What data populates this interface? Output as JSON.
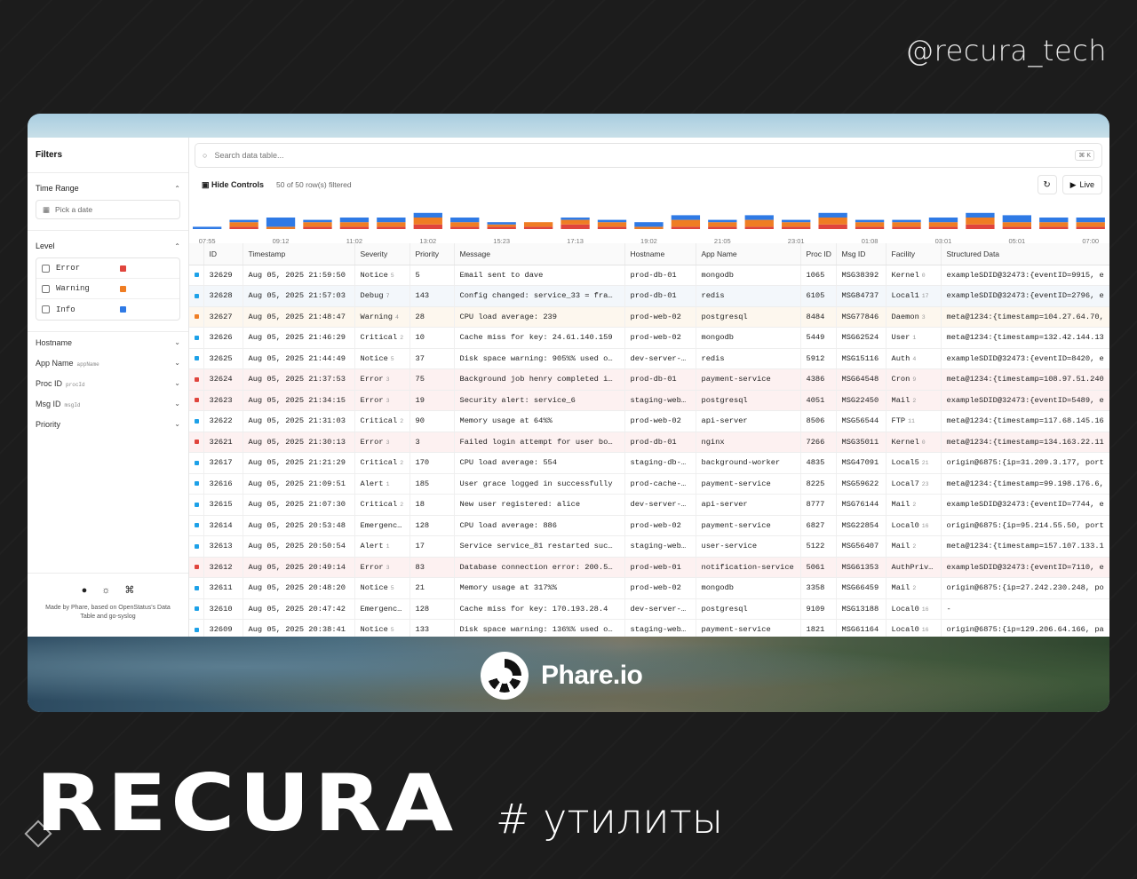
{
  "handle": "@recura_tech",
  "brand": {
    "name": "Phare.io"
  },
  "footer_brand": {
    "name": "RECURA",
    "tagline": "# утилиты"
  },
  "sidebar": {
    "title": "Filters",
    "time_range": {
      "label": "Time Range",
      "placeholder": "Pick a date"
    },
    "level": {
      "label": "Level",
      "items": [
        {
          "label": "Error",
          "color": "#e0453d"
        },
        {
          "label": "Warning",
          "color": "#ef7d23"
        },
        {
          "label": "Info",
          "color": "#2f7ae5"
        }
      ]
    },
    "facets": [
      {
        "label": "Hostname",
        "hint": ""
      },
      {
        "label": "App Name",
        "hint": "appName"
      },
      {
        "label": "Proc ID",
        "hint": "procId"
      },
      {
        "label": "Msg ID",
        "hint": "msgId"
      },
      {
        "label": "Priority",
        "hint": ""
      }
    ],
    "footer": {
      "line1": "Made by Phare, based on OpenStatus's Data",
      "line2": "Table and go-syslog"
    }
  },
  "search": {
    "placeholder": "Search data table...",
    "shortcut": "⌘ K"
  },
  "controls": {
    "hide_label": "Hide Controls",
    "count_label": "50 of 50 row(s) filtered",
    "live_label": "Live"
  },
  "chart_data": {
    "type": "bar",
    "categories": [
      "07:55",
      "",
      "09:12",
      "",
      "11:02",
      "",
      "13:02",
      "",
      "15:23",
      "",
      "17:13",
      "",
      "19:02",
      "",
      "21:05",
      "",
      "23:01",
      "",
      "01:08",
      "",
      "03:01",
      "",
      "05:01",
      "",
      "07:00"
    ],
    "tick_labels": [
      "07:55",
      "09:12",
      "11:02",
      "13:02",
      "15:23",
      "17:13",
      "19:02",
      "21:05",
      "23:01",
      "01:08",
      "03:01",
      "05:01",
      "07:00"
    ],
    "series": [],
    "values_blue": [
      1,
      1,
      4,
      1,
      2,
      2,
      2,
      2,
      1,
      0,
      1,
      1,
      2,
      2,
      1,
      2,
      1,
      2,
      1,
      1,
      2,
      2,
      3,
      2,
      2
    ],
    "values_orange": [
      0,
      2,
      1,
      2,
      2,
      2,
      3,
      2,
      1,
      2,
      2,
      2,
      1,
      3,
      2,
      3,
      2,
      3,
      2,
      2,
      2,
      3,
      2,
      2,
      2
    ],
    "values_red": [
      0,
      1,
      0,
      1,
      1,
      1,
      2,
      1,
      1,
      1,
      2,
      1,
      0,
      1,
      1,
      1,
      1,
      2,
      1,
      1,
      1,
      2,
      1,
      1,
      1
    ],
    "colors": {
      "blue": "#2f7ae5",
      "orange": "#ef7d23",
      "red": "#e0453d"
    }
  },
  "table": {
    "columns": [
      "ID",
      "Timestamp",
      "Severity",
      "Priority",
      "Message",
      "Hostname",
      "App Name",
      "Proc ID",
      "Msg ID",
      "Facility",
      "Structured Data"
    ],
    "rows": [
      {
        "lv": "info",
        "color": "#1da1e8",
        "id": "32629",
        "ts": "Aug 05, 2025 21:59:50",
        "sev": "Notice",
        "sevn": "5",
        "pri": "5",
        "msg": "Email sent to dave",
        "host": "prod-db-01",
        "app": "mongodb",
        "proc": "1065",
        "msgid": "MSG38392",
        "fac": "Kernel",
        "facn": "0",
        "sd": "exampleSDID@32473:{eventID=9915, e"
      },
      {
        "lv": "info",
        "color": "#1da1e8",
        "id": "32628",
        "ts": "Aug 05, 2025 21:57:03",
        "sev": "Debug",
        "sevn": "7",
        "pri": "143",
        "msg": "Config changed: service_33 = fra…",
        "host": "prod-db-01",
        "app": "redis",
        "proc": "6105",
        "msgid": "MSG84737",
        "fac": "Local1",
        "facn": "17",
        "sd": "exampleSDID@32473:{eventID=2796, e"
      },
      {
        "lv": "warning",
        "color": "#ef7d23",
        "id": "32627",
        "ts": "Aug 05, 2025 21:48:47",
        "sev": "Warning",
        "sevn": "4",
        "pri": "28",
        "msg": "CPU load average: 239",
        "host": "prod-web-02",
        "app": "postgresql",
        "proc": "8484",
        "msgid": "MSG77846",
        "fac": "Daemon",
        "facn": "3",
        "sd": "meta@1234:{timestamp=104.27.64.70,"
      },
      {
        "lv": "info",
        "color": "#1da1e8",
        "id": "32626",
        "ts": "Aug 05, 2025 21:46:29",
        "sev": "Critical",
        "sevn": "2",
        "pri": "10",
        "msg": "Cache miss for key: 24.61.140.159",
        "host": "prod-web-02",
        "app": "mongodb",
        "proc": "5449",
        "msgid": "MSG62524",
        "fac": "User",
        "facn": "1",
        "sd": "meta@1234:{timestamp=132.42.144.13"
      },
      {
        "lv": "info",
        "color": "#1da1e8",
        "id": "32625",
        "ts": "Aug 05, 2025 21:44:49",
        "sev": "Notice",
        "sevn": "5",
        "pri": "37",
        "msg": "Disk space warning: 905%% used o…",
        "host": "dev-server-…",
        "app": "redis",
        "proc": "5912",
        "msgid": "MSG15116",
        "fac": "Auth",
        "facn": "4",
        "sd": "exampleSDID@32473:{eventID=8420, e"
      },
      {
        "lv": "error",
        "color": "#e0453d",
        "id": "32624",
        "ts": "Aug 05, 2025 21:37:53",
        "sev": "Error",
        "sevn": "3",
        "pri": "75",
        "msg": "Background job henry completed i…",
        "host": "prod-db-01",
        "app": "payment-service",
        "proc": "4386",
        "msgid": "MSG64548",
        "fac": "Cron",
        "facn": "9",
        "sd": "meta@1234:{timestamp=108.97.51.240"
      },
      {
        "lv": "error",
        "color": "#e0453d",
        "id": "32623",
        "ts": "Aug 05, 2025 21:34:15",
        "sev": "Error",
        "sevn": "3",
        "pri": "19",
        "msg": "Security alert: service_6",
        "host": "staging-web…",
        "app": "postgresql",
        "proc": "4051",
        "msgid": "MSG22450",
        "fac": "Mail",
        "facn": "2",
        "sd": "exampleSDID@32473:{eventID=5489, e"
      },
      {
        "lv": "info",
        "color": "#1da1e8",
        "id": "32622",
        "ts": "Aug 05, 2025 21:31:03",
        "sev": "Critical",
        "sevn": "2",
        "pri": "90",
        "msg": "Memory usage at 64%%",
        "host": "prod-web-02",
        "app": "api-server",
        "proc": "8506",
        "msgid": "MSG56544",
        "fac": "FTP",
        "facn": "11",
        "sd": "meta@1234:{timestamp=117.68.145.16"
      },
      {
        "lv": "error",
        "color": "#e0453d",
        "id": "32621",
        "ts": "Aug 05, 2025 21:30:13",
        "sev": "Error",
        "sevn": "3",
        "pri": "3",
        "msg": "Failed login attempt for user bo…",
        "host": "prod-db-01",
        "app": "nginx",
        "proc": "7266",
        "msgid": "MSG35011",
        "fac": "Kernel",
        "facn": "0",
        "sd": "meta@1234:{timestamp=134.163.22.11"
      },
      {
        "lv": "info",
        "color": "#1da1e8",
        "id": "32617",
        "ts": "Aug 05, 2025 21:21:29",
        "sev": "Critical",
        "sevn": "2",
        "pri": "170",
        "msg": "CPU load average: 554",
        "host": "staging-db-…",
        "app": "background-worker",
        "proc": "4835",
        "msgid": "MSG47091",
        "fac": "Local5",
        "facn": "21",
        "sd": "origin@6875:{ip=31.209.3.177, port"
      },
      {
        "lv": "info",
        "color": "#1da1e8",
        "id": "32616",
        "ts": "Aug 05, 2025 21:09:51",
        "sev": "Alert",
        "sevn": "1",
        "pri": "185",
        "msg": "User grace logged in successfully",
        "host": "prod-cache-…",
        "app": "payment-service",
        "proc": "8225",
        "msgid": "MSG59622",
        "fac": "Local7",
        "facn": "23",
        "sd": "meta@1234:{timestamp=99.198.176.6,"
      },
      {
        "lv": "info",
        "color": "#1da1e8",
        "id": "32615",
        "ts": "Aug 05, 2025 21:07:30",
        "sev": "Critical",
        "sevn": "2",
        "pri": "18",
        "msg": "New user registered: alice",
        "host": "dev-server-…",
        "app": "api-server",
        "proc": "8777",
        "msgid": "MSG76144",
        "fac": "Mail",
        "facn": "2",
        "sd": "exampleSDID@32473:{eventID=7744, e"
      },
      {
        "lv": "info",
        "color": "#1da1e8",
        "id": "32614",
        "ts": "Aug 05, 2025 20:53:48",
        "sev": "Emergency",
        "sevn": "0",
        "pri": "128",
        "msg": "CPU load average: 886",
        "host": "prod-web-02",
        "app": "payment-service",
        "proc": "6827",
        "msgid": "MSG22854",
        "fac": "Local0",
        "facn": "16",
        "sd": "origin@6875:{ip=95.214.55.50, port"
      },
      {
        "lv": "info",
        "color": "#1da1e8",
        "id": "32613",
        "ts": "Aug 05, 2025 20:50:54",
        "sev": "Alert",
        "sevn": "1",
        "pri": "17",
        "msg": "Service service_81 restarted suc…",
        "host": "staging-web…",
        "app": "user-service",
        "proc": "5122",
        "msgid": "MSG56407",
        "fac": "Mail",
        "facn": "2",
        "sd": "meta@1234:{timestamp=157.107.133.1"
      },
      {
        "lv": "error",
        "color": "#e0453d",
        "id": "32612",
        "ts": "Aug 05, 2025 20:49:14",
        "sev": "Error",
        "sevn": "3",
        "pri": "83",
        "msg": "Database connection error: 200.5…",
        "host": "prod-web-01",
        "app": "notification-service",
        "proc": "5061",
        "msgid": "MSG61353",
        "fac": "AuthPriv",
        "facn": "10",
        "sd": "exampleSDID@32473:{eventID=7110, e"
      },
      {
        "lv": "info",
        "color": "#1da1e8",
        "id": "32611",
        "ts": "Aug 05, 2025 20:48:20",
        "sev": "Notice",
        "sevn": "5",
        "pri": "21",
        "msg": "Memory usage at 317%%",
        "host": "prod-web-02",
        "app": "mongodb",
        "proc": "3358",
        "msgid": "MSG66459",
        "fac": "Mail",
        "facn": "2",
        "sd": "origin@6875:{ip=27.242.230.248, po"
      },
      {
        "lv": "info",
        "color": "#1da1e8",
        "id": "32610",
        "ts": "Aug 05, 2025 20:47:42",
        "sev": "Emergency",
        "sevn": "0",
        "pri": "128",
        "msg": "Cache miss for key: 170.193.28.4",
        "host": "dev-server-…",
        "app": "postgresql",
        "proc": "9109",
        "msgid": "MSG13188",
        "fac": "Local0",
        "facn": "16",
        "sd": "-"
      },
      {
        "lv": "info",
        "color": "#1da1e8",
        "id": "32609",
        "ts": "Aug 05, 2025 20:38:41",
        "sev": "Notice",
        "sevn": "5",
        "pri": "133",
        "msg": "Disk space warning: 136%% used o…",
        "host": "staging-web…",
        "app": "payment-service",
        "proc": "1821",
        "msgid": "MSG61164",
        "fac": "Local0",
        "facn": "16",
        "sd": "origin@6875:{ip=129.206.64.166, pa"
      }
    ]
  }
}
